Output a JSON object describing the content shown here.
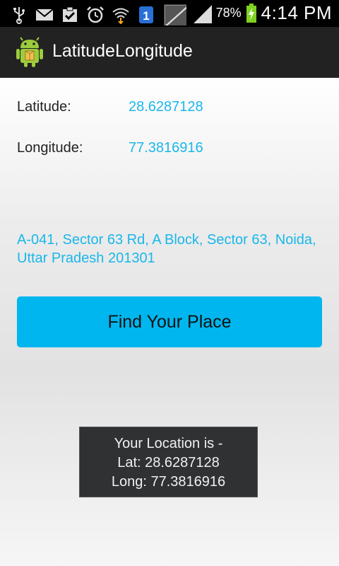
{
  "status_bar": {
    "icons_left": [
      "usb-icon",
      "email-icon",
      "clipboard-check-icon",
      "alarm-clock-icon",
      "wifi-download-icon",
      "notification-1-icon",
      "no-signal-icon",
      "signal-icon"
    ],
    "notification_number": "1",
    "battery_percent": "78%",
    "time": "4:14 PM",
    "battery_color": "#7ed321"
  },
  "action_bar": {
    "title": "LatitudeLongitude",
    "icon": "android-icon"
  },
  "main": {
    "latitude_label": "Latitude:",
    "latitude_value": "28.6287128",
    "longitude_label": "Longitude:",
    "longitude_value": "77.3816916",
    "address": "A-041, Sector 63 Rd, A Block, Sector 63, Noida, Uttar Pradesh 201301",
    "find_button_label": "Find Your Place"
  },
  "toast": {
    "line1": "Your Location is -",
    "line2": "Lat: 28.6287128",
    "line3": "Long: 77.3816916"
  },
  "colors": {
    "accent": "#1ab7ea",
    "button": "#00b6ee",
    "action_bar": "#222222"
  }
}
